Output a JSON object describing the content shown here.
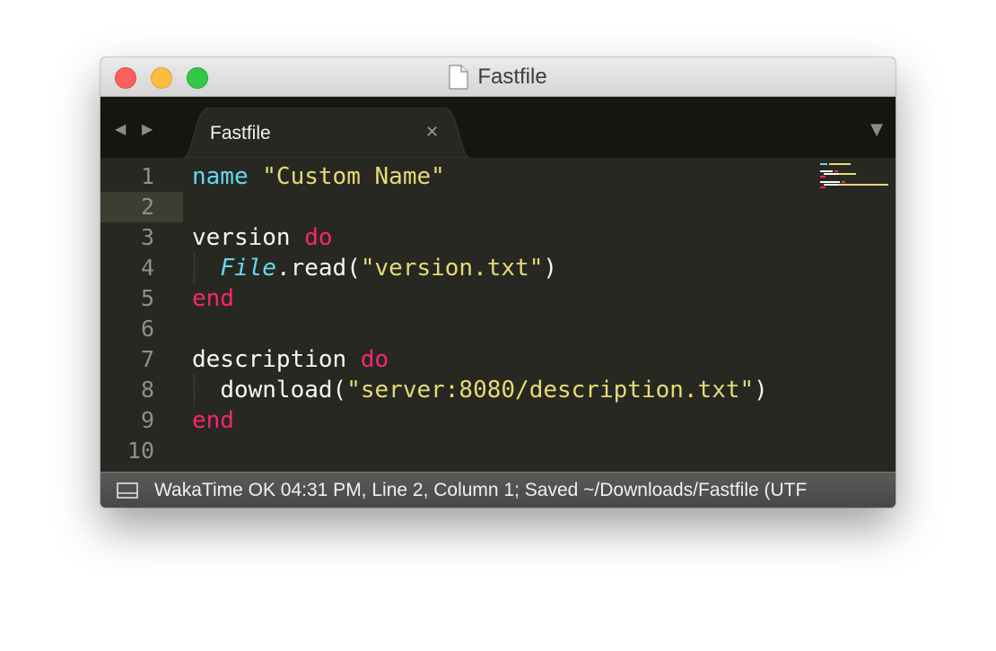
{
  "window": {
    "title": "Fastfile"
  },
  "tabs": [
    {
      "label": "Fastfile",
      "close_icon": "close-icon"
    }
  ],
  "navigation": {
    "back_icon": "arrow-left-icon",
    "forward_icon": "arrow-right-icon",
    "tab_menu_icon": "dropdown-icon"
  },
  "editor": {
    "line_numbers": [
      "1",
      "2",
      "3",
      "4",
      "5",
      "6",
      "7",
      "8",
      "9",
      "10"
    ],
    "current_line": "2",
    "lines": {
      "l1": {
        "ident": "name",
        "space": " ",
        "string": "\"Custom Name\""
      },
      "l3": {
        "ident": "version",
        "space": " ",
        "keyword": "do"
      },
      "l4": {
        "indent": "  ",
        "const": "File",
        "method": ".read(",
        "string": "\"version.txt\"",
        "close": ")"
      },
      "l5": {
        "keyword": "end"
      },
      "l7": {
        "ident": "description",
        "space": " ",
        "keyword": "do"
      },
      "l8": {
        "indent": "  ",
        "method": "download(",
        "string": "\"server:8080/description.txt\"",
        "close": ")"
      },
      "l9": {
        "keyword": "end"
      }
    }
  },
  "status_bar": {
    "panel_icon": "panel-toggle-icon",
    "text": "WakaTime OK 04:31 PM, Line 2, Column 1; Saved ~/Downloads/Fastfile (UTF"
  },
  "colors": {
    "background": "#272822",
    "keyword": "#f92672",
    "function": "#66d9ef",
    "string": "#e6db74",
    "text": "#f8f8f2",
    "line_number": "#8f908a"
  }
}
